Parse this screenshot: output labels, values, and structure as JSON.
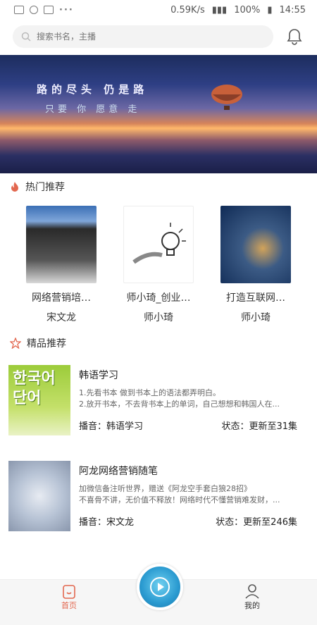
{
  "status": {
    "speed": "0.59K/s",
    "battery": "100%",
    "time": "14:55"
  },
  "search": {
    "placeholder": "搜索书名，主播"
  },
  "banner": {
    "line1": "路的尽头 仍是路",
    "line2": "只要 你 愿意 走"
  },
  "hot": {
    "title": "热门推荐",
    "items": [
      {
        "title": "网络营销培…",
        "author": "宋文龙"
      },
      {
        "title": "师小琦_创业…",
        "author": "师小琦"
      },
      {
        "title": "打造互联网…",
        "author": "师小琦"
      }
    ]
  },
  "featured": {
    "title": "精品推荐",
    "items": [
      {
        "title": "韩语学习",
        "desc1": "1.先看书本 做到书本上的语法都弄明白。",
        "desc2": "2.放开书本，不去背书本上的单词，自己想想和韩国人在...",
        "host": "播音：韩语学习",
        "status": "状态：更新至31集",
        "cover_text": "한국어 단어"
      },
      {
        "title": "阿龙网络营销随笔",
        "desc1": "加微信备注听世界，赠送《阿龙空手套白狼28招》",
        "desc2": "不喜骨不讲，无价值不释放！网络时代不懂营销难发财，...",
        "host": "播音：宋文龙",
        "status": "状态：更新至246集"
      }
    ]
  },
  "tabs": {
    "home": "首页",
    "mine": "我的"
  },
  "colors": {
    "accent": "#e2674f",
    "play": "#2a9ad0"
  }
}
